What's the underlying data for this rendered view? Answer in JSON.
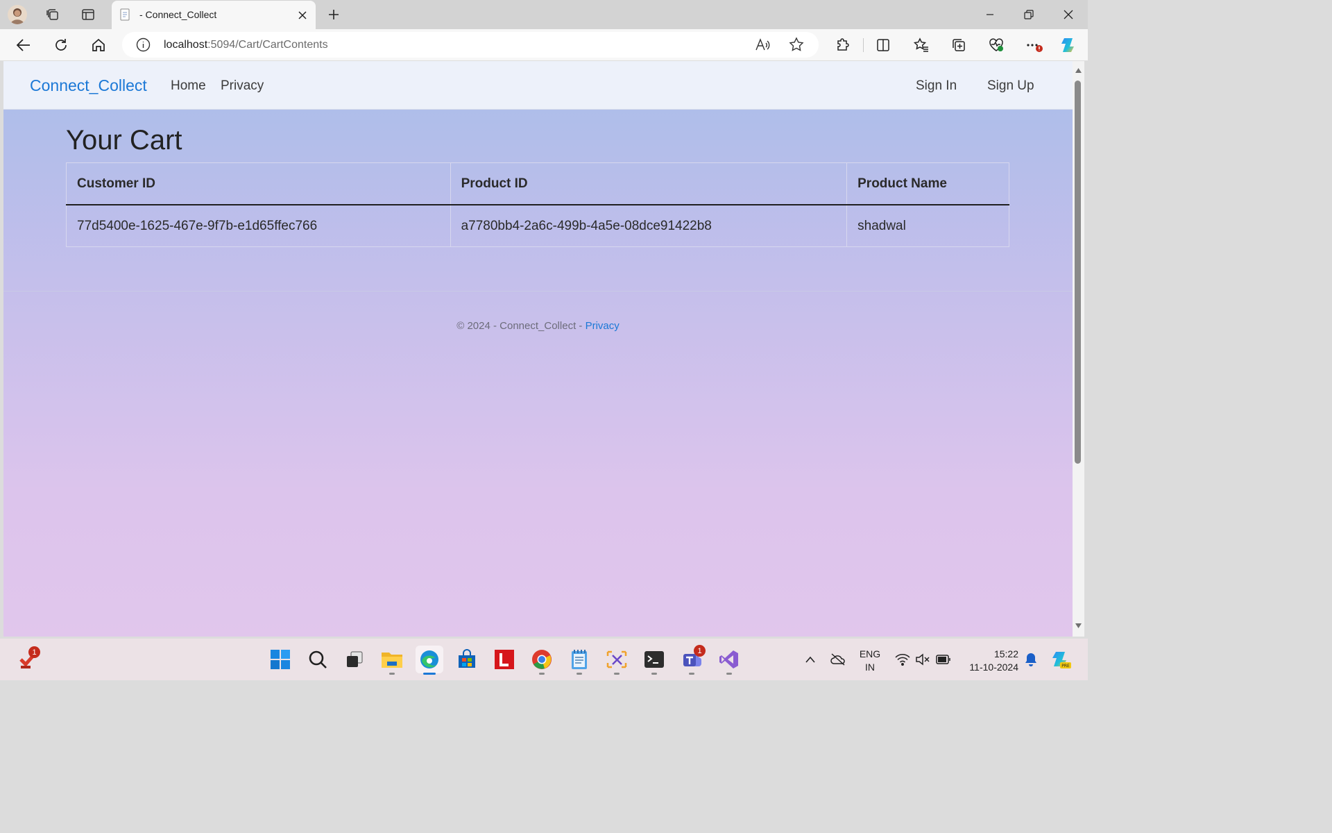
{
  "browser": {
    "tab_title": "- Connect_Collect",
    "url_host": "localhost",
    "url_rest": ":5094/Cart/CartContents",
    "icons": {
      "profile": "profile-avatar",
      "workspaces": "workspaces-icon",
      "tab_actions": "tab-actions-icon",
      "back": "back-arrow-icon",
      "refresh": "refresh-icon",
      "home": "home-icon",
      "site_info": "info-icon",
      "read_aloud": "read-aloud-icon",
      "favorite": "star-icon",
      "extensions": "puzzle-icon",
      "split_screen": "split-screen-icon",
      "favorites": "favorites-icon",
      "collections": "collections-icon",
      "browser_essentials": "heart-pulse-icon",
      "more": "more-icon",
      "copilot": "copilot-icon"
    }
  },
  "site": {
    "brand": "Connect_Collect",
    "nav": {
      "home": "Home",
      "privacy": "Privacy",
      "sign_in": "Sign In",
      "sign_up": "Sign Up"
    },
    "page_title": "Your Cart",
    "table": {
      "headers": [
        "Customer ID",
        "Product ID",
        "Product Name"
      ],
      "rows": [
        [
          "77d5400e-1625-467e-9f7b-e1d65ffec766",
          "a7780bb4-2a6c-499b-4a5e-08dce91422b8",
          "shadwal"
        ]
      ]
    },
    "footer": {
      "text": "© 2024 - Connect_Collect - ",
      "link": "Privacy"
    },
    "colors": {
      "brand": "#1b78d6",
      "navbar_bg": "#edf1fa",
      "gradient_top": "#a9bdea",
      "gradient_bottom": "#e1c6ec"
    }
  },
  "taskbar": {
    "apps": [
      "antivirus",
      "start",
      "search",
      "task-view",
      "file-explorer",
      "edge",
      "microsoft-store",
      "l-app",
      "chrome",
      "notepad",
      "snipping-tool",
      "terminal",
      "teams",
      "visual-studio"
    ],
    "badges": {
      "antivirus": "1",
      "teams": "1"
    },
    "lang_line1": "ENG",
    "lang_line2": "IN",
    "time": "15:22",
    "date": "11-10-2024"
  }
}
